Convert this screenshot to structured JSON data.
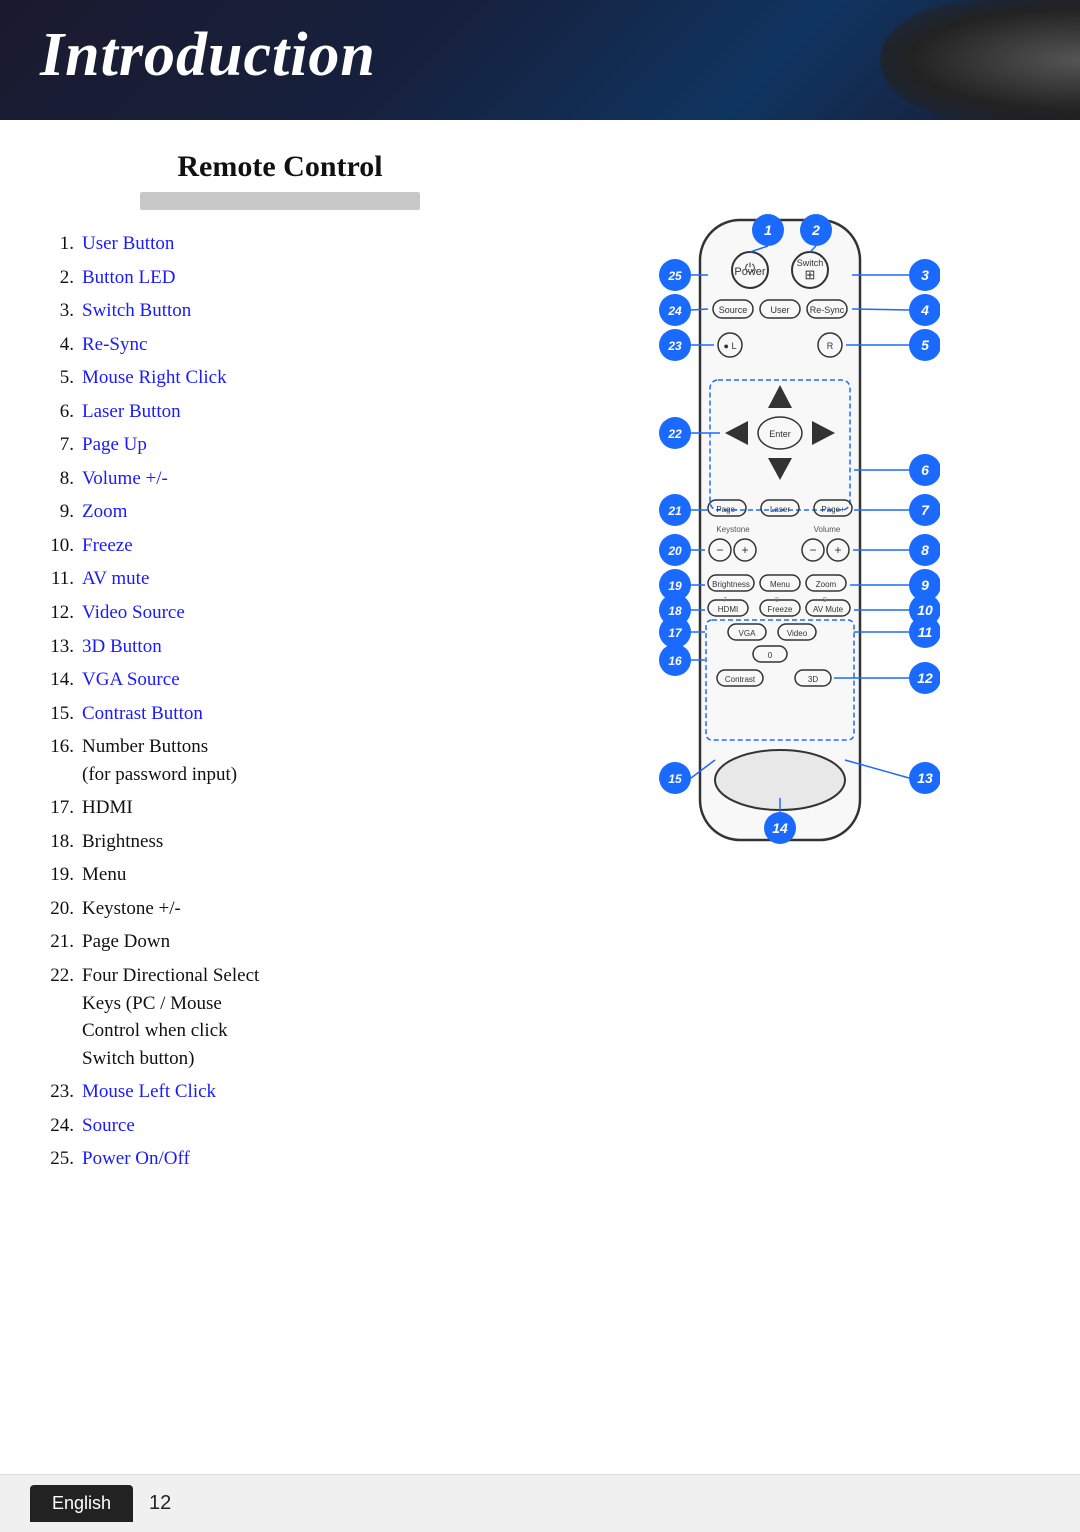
{
  "header": {
    "title": "Introduction"
  },
  "section": {
    "heading": "Remote Control"
  },
  "items": [
    {
      "num": "1.",
      "label": "User Button",
      "blue": true
    },
    {
      "num": "2.",
      "label": "Button LED",
      "blue": true
    },
    {
      "num": "3.",
      "label": "Switch Button",
      "blue": true
    },
    {
      "num": "4.",
      "label": "Re-Sync",
      "blue": true
    },
    {
      "num": "5.",
      "label": "Mouse Right Click",
      "blue": true
    },
    {
      "num": "6.",
      "label": "Laser Button",
      "blue": true
    },
    {
      "num": "7.",
      "label": "Page Up",
      "blue": true
    },
    {
      "num": "8.",
      "label": "Volume +/-",
      "blue": true
    },
    {
      "num": "9.",
      "label": "Zoom",
      "blue": true
    },
    {
      "num": "10.",
      "label": "Freeze",
      "blue": true
    },
    {
      "num": "11.",
      "label": "AV mute",
      "blue": true
    },
    {
      "num": "12.",
      "label": "Video Source",
      "blue": true
    },
    {
      "num": "13.",
      "label": "3D Button",
      "blue": true
    },
    {
      "num": "14.",
      "label": "VGA Source",
      "blue": true
    },
    {
      "num": "15.",
      "label": "Contrast Button",
      "blue": true
    },
    {
      "num": "16.",
      "label": "Number Buttons\n(for password input)",
      "blue": false
    },
    {
      "num": "17.",
      "label": "HDMI",
      "blue": false
    },
    {
      "num": "18.",
      "label": "Brightness",
      "blue": false
    },
    {
      "num": "19.",
      "label": "Menu",
      "blue": false
    },
    {
      "num": "20.",
      "label": "Keystone +/-",
      "blue": false
    },
    {
      "num": "21.",
      "label": "Page Down",
      "blue": false
    },
    {
      "num": "22.",
      "label": "Four Directional Select\nKeys (PC / Mouse\nControl when click\nSwitch button)",
      "blue": false
    },
    {
      "num": "23.",
      "label": "Mouse Left Click",
      "blue": true
    },
    {
      "num": "24.",
      "label": "Source",
      "blue": true
    },
    {
      "num": "25.",
      "label": "Power On/Off",
      "blue": true
    }
  ],
  "footer": {
    "language": "English",
    "page": "12"
  }
}
